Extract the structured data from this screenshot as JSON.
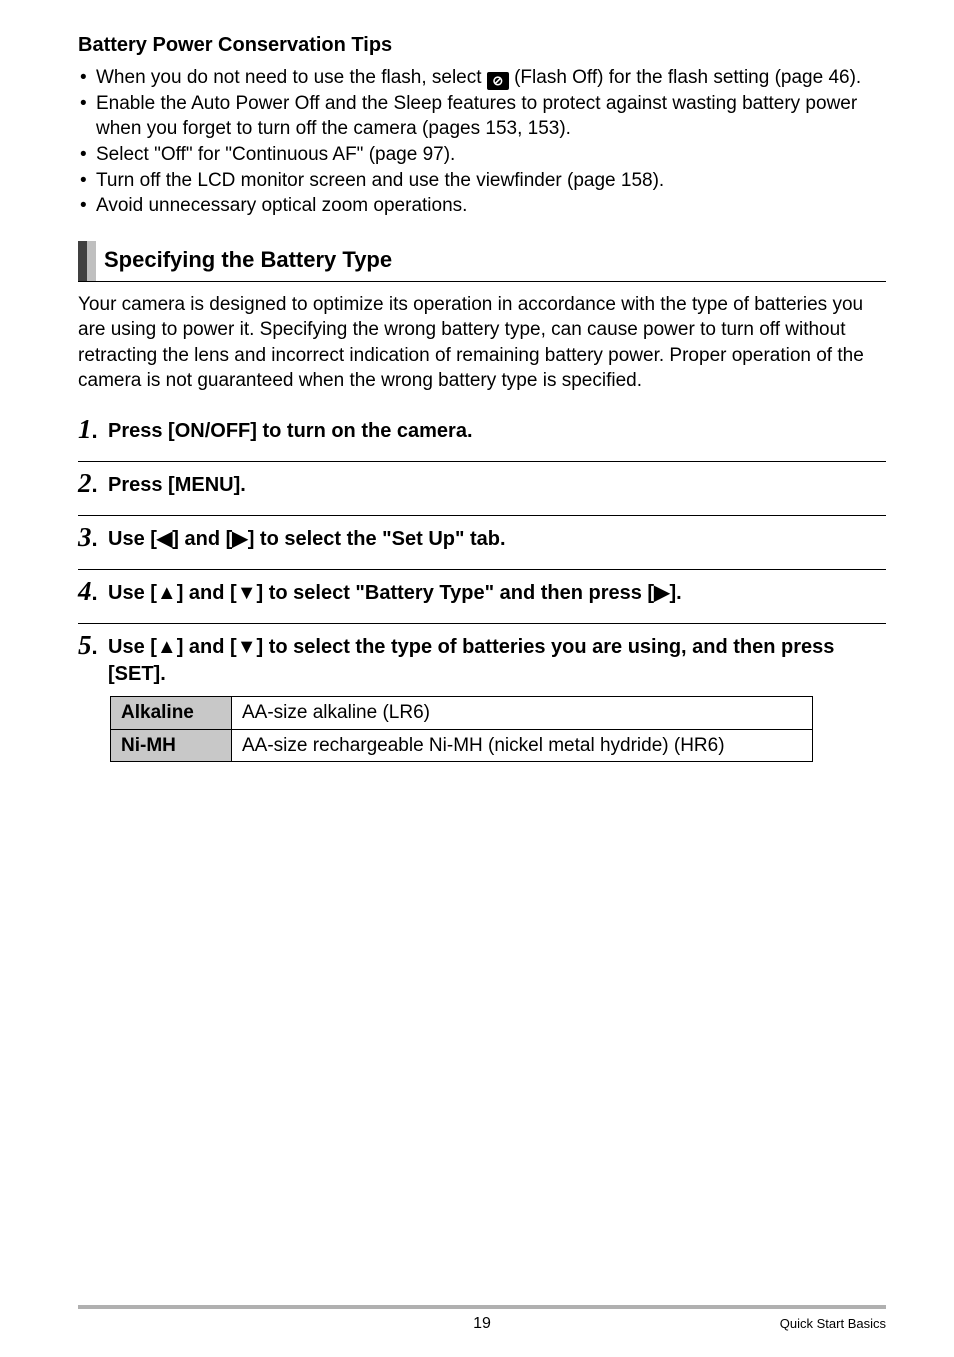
{
  "tips": {
    "heading": "Battery Power Conservation Tips",
    "item1_pre": "When you do not need to use the flash, select ",
    "item1_post": " (Flash Off) for the flash setting (page 46).",
    "flash_icon_glyph": "⊘",
    "item2": "Enable the Auto Power Off and the Sleep features to protect against wasting battery power when you forget to turn off the camera (pages 153, 153).",
    "item3": "Select \"Off\" for \"Continuous AF\" (page 97).",
    "item4": "Turn off the LCD monitor screen and use the viewfinder (page 158).",
    "item5": "Avoid unnecessary optical zoom operations."
  },
  "section": {
    "heading": "Specifying the Battery Type",
    "para": "Your camera is designed to optimize its operation in accordance with the type of batteries you are using to power it. Specifying the wrong battery type, can cause power to turn off without retracting the lens and incorrect indication of remaining battery power. Proper operation of the camera is not guaranteed when the wrong battery type is specified."
  },
  "steps": {
    "s1_num": "1",
    "s1": "Press [ON/OFF] to turn on the camera.",
    "s2_num": "2",
    "s2": "Press [MENU].",
    "s3_num": "3",
    "s3_a": "Use [",
    "s3_b": "] and [",
    "s3_c": "] to select the \"Set Up\" tab.",
    "s4_num": "4",
    "s4_a": "Use [",
    "s4_b": "] and [",
    "s4_c": "] to select \"Battery Type\" and then press [",
    "s4_d": "].",
    "s5_num": "5",
    "s5_a": "Use [",
    "s5_b": "] and [",
    "s5_c": "] to select the type of batteries you are using, and then press [SET]."
  },
  "arrows": {
    "left": "◀",
    "right": "▶",
    "up": "▲",
    "down": "▼"
  },
  "table": {
    "r1h": "Alkaline",
    "r1d": "AA-size alkaline (LR6)",
    "r2h": "Ni-MH",
    "r2d": "AA-size rechargeable Ni-MH (nickel metal hydride) (HR6)"
  },
  "footer": {
    "page": "19",
    "section": "Quick Start Basics"
  }
}
